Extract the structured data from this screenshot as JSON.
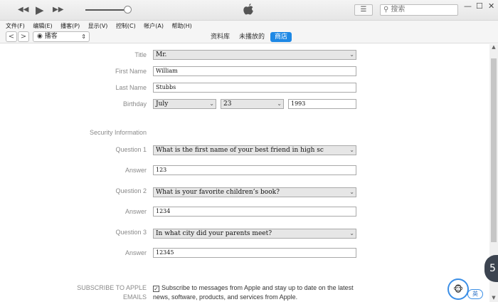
{
  "toolbar": {
    "rewind": "◀◀",
    "play": "▶",
    "forward": "▶▶",
    "search_placeholder": "搜索",
    "window_minimize": "—",
    "window_restore": "☐",
    "window_close": "✕"
  },
  "menu": [
    "文件(F)",
    "编辑(E)",
    "播客(P)",
    "显示(V)",
    "控制(C)",
    "帐户(A)",
    "帮助(H)"
  ],
  "nav": {
    "back": "<",
    "forward": ">",
    "media_label": "播客",
    "tabs": [
      "资料库",
      "未播放的",
      "商店"
    ],
    "active_tab": "商店"
  },
  "form": {
    "title_label": "Title",
    "title_value": "Mr.",
    "first_name_label": "First Name",
    "first_name_value": "William",
    "last_name_label": "Last Name",
    "last_name_value": "Stubbs",
    "birthday_label": "Birthday",
    "birthday_month": "July",
    "birthday_day": "23",
    "birthday_year": "1993",
    "security_heading": "Security Information",
    "q1_label": "Question 1",
    "q1_value": "What is the first name of your best friend in high sc",
    "a1_label": "Answer",
    "a1_value": "123",
    "q2_label": "Question 2",
    "q2_value": "What is your favorite children’s book?",
    "a2_label": "Answer",
    "a2_value": "1234",
    "q3_label": "Question 3",
    "q3_value": "In what city did your parents meet?",
    "a3_label": "Answer",
    "a3_value": "12345",
    "subscribe_label_1": "SUBSCRIBE TO APPLE",
    "subscribe_label_2": "EMAILS",
    "subscribe_text_1": "Subscribe to messages from Apple and stay up to date on the latest",
    "subscribe_text_2": "news, software, products, and services from Apple."
  },
  "side_badge": "5",
  "ime": {
    "lang": "英"
  },
  "colors": {
    "accent": "#1e88e5",
    "label": "#8a8a8a"
  }
}
